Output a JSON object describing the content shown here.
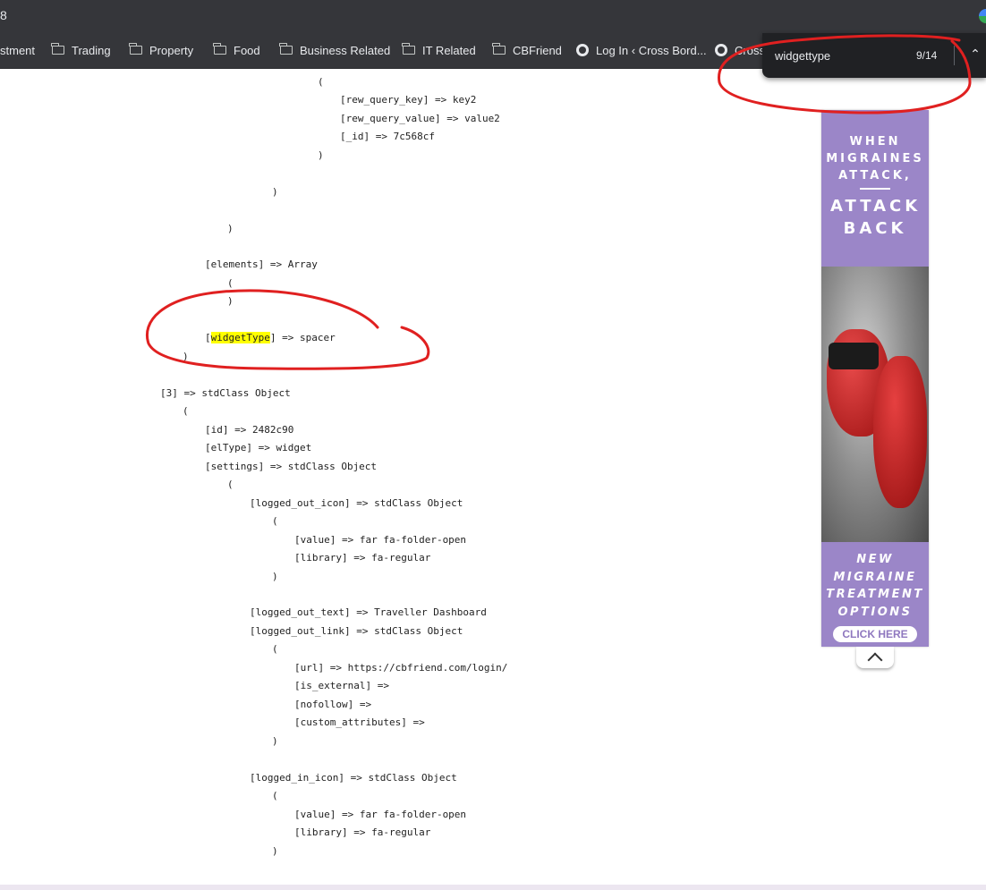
{
  "browser": {
    "url_fragment": "8",
    "bookmarks": [
      {
        "label": "stment",
        "icon": "folder-icon"
      },
      {
        "label": "Trading",
        "icon": "folder-icon"
      },
      {
        "label": "Property",
        "icon": "folder-icon"
      },
      {
        "label": "Food",
        "icon": "folder-icon"
      },
      {
        "label": "Business Related",
        "icon": "folder-icon"
      },
      {
        "label": "IT Related",
        "icon": "folder-icon"
      },
      {
        "label": "CBFriend",
        "icon": "folder-icon"
      },
      {
        "label": "Log In ‹ Cross Bord...",
        "icon": "site-icon"
      },
      {
        "label": "Cross",
        "icon": "site-icon"
      }
    ]
  },
  "find_bar": {
    "query": "widgettype",
    "count": "9/14"
  },
  "code": {
    "l1": "(",
    "l2": "[rew_query_key] => key2",
    "l3": "[rew_query_value] => value2",
    "l4": "[_id] => 7c568cf",
    "l5": ")",
    "l6": ")",
    "l7": ")",
    "l8": "[elements] => Array",
    "l9": "(",
    "l10": ")",
    "l11_open": "[",
    "l11_highlight": "widgetType",
    "l11_rest": "] => spacer",
    "l12": ")",
    "l13": "[3] => stdClass Object",
    "l14": "(",
    "l15": "[id] => 2482c90",
    "l16": "[elType] => widget",
    "l17": "[settings] => stdClass Object",
    "l18": "(",
    "l19": "[logged_out_icon] => stdClass Object",
    "l20": "(",
    "l21": "[value] => far fa-folder-open",
    "l22": "[library] => fa-regular",
    "l23": ")",
    "l24": "[logged_out_text] => Traveller Dashboard",
    "l25": "[logged_out_link] => stdClass Object",
    "l26": "(",
    "l27": "[url] => https://cbfriend.com/login/",
    "l28": "[is_external] =>",
    "l29": "[nofollow] =>",
    "l30": "[custom_attributes] =>",
    "l31": ")",
    "l32": "[logged_in_icon] => stdClass Object",
    "l33": "(",
    "l34": "[value] => far fa-folder-open",
    "l35": "[library] => fa-regular",
    "l36": ")"
  },
  "ad": {
    "headline_1": "WHEN MIGRAINES ATTACK,",
    "headline_2": "ATTACK BACK",
    "footer": "NEW MIGRAINE TREATMENT OPTIONS",
    "cta": "CLICK HERE"
  },
  "colors": {
    "browser_chrome": "#35363a",
    "find_bar": "#202124",
    "ad_purple": "#9b86c8",
    "highlight": "#ffff00",
    "annotation_red": "#e02020"
  }
}
